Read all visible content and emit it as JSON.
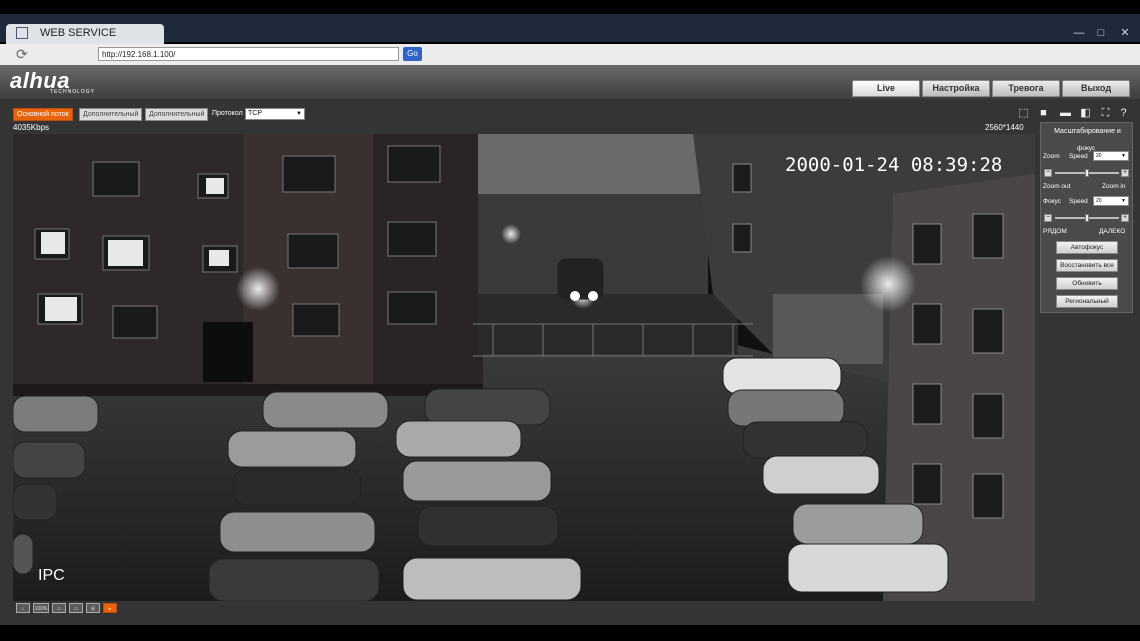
{
  "browser": {
    "tab_title": "WEB SERVICE",
    "url": "http://192.168.1.100/",
    "go_label": "Go",
    "window_buttons": [
      "—",
      "□",
      "✕"
    ]
  },
  "header": {
    "logo": "alhua",
    "logo_sub": "TECHNOLOGY",
    "nav": [
      "Live",
      "Настройка",
      "Тревога",
      "Выход"
    ]
  },
  "toolbar": {
    "streams": [
      "Основной поток",
      "Дополнительный",
      "Дополнительный"
    ],
    "protocol_label": "Протокол",
    "protocol_value": "TCP",
    "bitrate": "4035Kbps",
    "resolution": "2560*1440"
  },
  "video": {
    "timestamp": "2000-01-24 08:39:28",
    "channel_label": "IPC"
  },
  "ptz": {
    "title": "Масштабирование и",
    "zoom_label": "Zoom",
    "focus_small": "фокус",
    "speed_label": "Speed",
    "zoom_speed": "20",
    "zoom_out": "Zoom out",
    "zoom_in": "Zoom in",
    "focus_label": "Фокус",
    "focus_speed": "20",
    "near": "РЯДОМ",
    "far": "ДАЛЕКО",
    "buttons": [
      "Автофокус",
      "Восстановить все",
      "Обновить",
      "Региональный"
    ]
  },
  "bottom_tools": [
    "⌂",
    "100%",
    "▭",
    "▭",
    "⊞",
    "▸"
  ],
  "colors": {
    "accent": "#e8640c",
    "go": "#2e64c7"
  }
}
